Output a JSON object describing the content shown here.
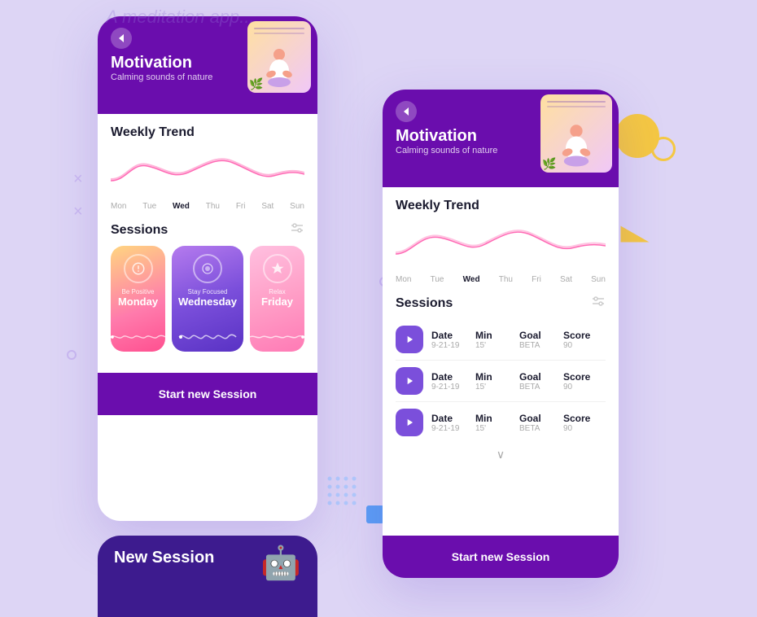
{
  "background_color": "#ddd5f5",
  "app_title": "Meditation App",
  "left_phone": {
    "header": {
      "back_label": "‹",
      "title": "Motivation",
      "subtitle": "Calming sounds of nature"
    },
    "weekly_trend": {
      "title": "Weekly Trend",
      "days": [
        "Mon",
        "Tue",
        "Wed",
        "Thu",
        "Fri",
        "Sat",
        "Sun"
      ],
      "active_day": "Wed"
    },
    "sessions": {
      "title": "Sessions",
      "cards": [
        {
          "sub": "Be Positive",
          "day": "Monday",
          "type": "monday"
        },
        {
          "sub": "Stay Focused",
          "day": "Wednesday",
          "type": "wednesday"
        },
        {
          "sub": "Relax",
          "day": "Friday",
          "type": "friday"
        }
      ]
    },
    "footer_label": "Start new Session"
  },
  "right_phone": {
    "header": {
      "back_label": "‹",
      "title": "Motivation",
      "subtitle": "Calming sounds of nature"
    },
    "weekly_trend": {
      "title": "Weekly Trend",
      "days": [
        "Mon",
        "Tue",
        "Wed",
        "Thu",
        "Fri",
        "Sat",
        "Sun"
      ],
      "active_day": "Wed"
    },
    "sessions": {
      "title": "Sessions",
      "rows": [
        {
          "date_label": "Date",
          "date_val": "9-21-19",
          "min_label": "Min",
          "min_val": "15'",
          "goal_label": "Goal",
          "goal_val": "BETA",
          "score_label": "Score",
          "score_val": "90"
        },
        {
          "date_label": "Date",
          "date_val": "9-21-19",
          "min_label": "Min",
          "min_val": "15'",
          "goal_label": "Goal",
          "goal_val": "BETA",
          "score_label": "Score",
          "score_val": "90"
        },
        {
          "date_label": "Date",
          "date_val": "9-21-19",
          "min_label": "Min",
          "min_val": "15'",
          "goal_label": "Goal",
          "goal_val": "BETA",
          "score_label": "Score",
          "score_val": "90"
        }
      ]
    },
    "footer_label": "Start new Session",
    "chevron": "∨"
  },
  "bottom_phone": {
    "title": "New Session"
  },
  "decorative": {
    "yellow_circle_color": "#f5c842",
    "outline_circle_color": "#f5c842",
    "triangle_color": "#f5c842",
    "cross_color": "#c9b8f0",
    "dot_color": "#a0c8ff"
  }
}
